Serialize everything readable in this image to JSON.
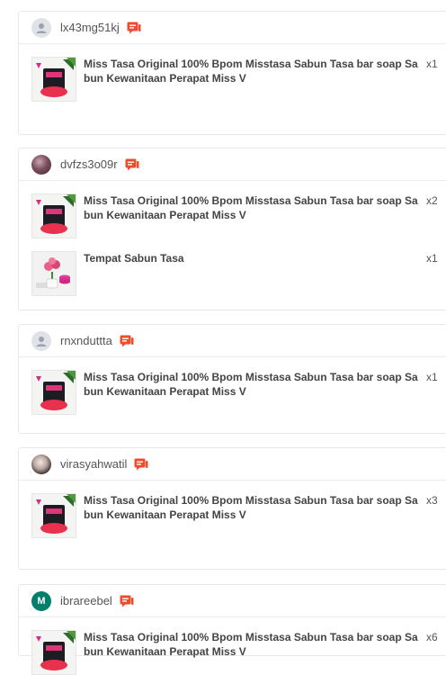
{
  "colors": {
    "accent": "#ee4d2d",
    "avatar_letter_bg": "#00806a"
  },
  "orders": [
    {
      "username": "lx43mg51kj",
      "avatar": "default-user-icon",
      "items": [
        {
          "name": "Miss Tasa Original 100% Bpom Misstasa Sabun Tasa bar soap Sabun Kewanitaan Perapat Miss V",
          "qty": "x1",
          "image": "soap-product-image"
        }
      ]
    },
    {
      "username": "dvfzs3o09r",
      "avatar": "user-photo",
      "items": [
        {
          "name": "Miss Tasa Original 100% Bpom Misstasa Sabun Tasa bar soap Sabun Kewanitaan Perapat Miss V",
          "qty": "x2",
          "image": "soap-product-image"
        },
        {
          "name": "Tempat Sabun Tasa",
          "qty": "x1",
          "image": "soap-holder-image"
        }
      ]
    },
    {
      "username": "rnxnduttta",
      "avatar": "default-user-icon",
      "items": [
        {
          "name": "Miss Tasa Original 100% Bpom Misstasa Sabun Tasa bar soap Sabun Kewanitaan Perapat Miss V",
          "qty": "x1",
          "image": "soap-product-image"
        }
      ]
    },
    {
      "username": "virasyahwatil",
      "avatar": "user-photo",
      "items": [
        {
          "name": "Miss Tasa Original 100% Bpom Misstasa Sabun Tasa bar soap Sabun Kewanitaan Perapat Miss V",
          "qty": "x3",
          "image": "soap-product-image"
        }
      ]
    },
    {
      "username": "ibrareebel",
      "avatar_letter": "M",
      "items": [
        {
          "name": "Miss Tasa Original 100% Bpom Misstasa Sabun Tasa bar soap Sabun Kewanitaan Perapat Miss V",
          "qty": "x6",
          "image": "soap-product-image"
        }
      ]
    }
  ]
}
